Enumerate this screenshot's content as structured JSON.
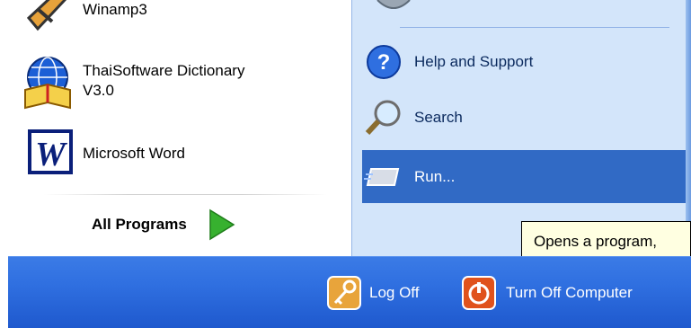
{
  "programs": [
    {
      "id": "winamp",
      "label": "Winamp3",
      "icon": "winamp-icon"
    },
    {
      "id": "thaisoftware",
      "label_line1": "ThaiSoftware Dictionary",
      "label_line2": "V3.0",
      "icon": "globe-dictionary-icon"
    },
    {
      "id": "word",
      "label": "Microsoft Word",
      "icon": "word-icon"
    }
  ],
  "all_programs": {
    "label": "All Programs",
    "icon": "green-arrow-icon"
  },
  "right_menu": [
    {
      "id": "help",
      "label": "Help and Support",
      "icon": "help-icon"
    },
    {
      "id": "search",
      "label": "Search",
      "icon": "magnifier-icon"
    },
    {
      "id": "run",
      "label": "Run...",
      "icon": "run-icon",
      "selected": true
    }
  ],
  "tooltip": "Opens a program,",
  "bottom_buttons": [
    {
      "id": "logoff",
      "label": "Log Off",
      "icon": "key-icon"
    },
    {
      "id": "turnoff",
      "label": "Turn Off Computer",
      "icon": "power-icon"
    }
  ],
  "colors": {
    "right_bg": "#d3e5fa",
    "selected": "#316ac5",
    "taskbar": "#2f6fe0",
    "tooltip_bg": "#ffffe1"
  }
}
